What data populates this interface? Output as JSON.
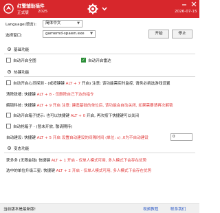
{
  "titlebar": {
    "app_title": "红警辅助插件",
    "edition": "正式版",
    "year": "2025",
    "date": "2026-07-15",
    "icons": [
      "logo-icon",
      "gear-icon",
      "chevron-down-icon",
      "minimize-icon",
      "close-icon"
    ]
  },
  "settings": {
    "language_label": "Language(语言):",
    "language_value": "简体中文",
    "process_label": "选择窗口:",
    "process_value": "gamemd-spawn.exe",
    "start_label": "开始",
    "stop_label": "停止"
  },
  "basic": {
    "title": "基础功能",
    "auto_ally_label": "自动开启全图",
    "auto_ally_checked": false,
    "auto_radar_label": "自动开启雷达",
    "auto_radar_checked": true
  },
  "hotkeys": {
    "title": "热键功能",
    "rows": [
      {
        "checked": false,
        "pre": "自动开启心灵探测 - (或按键键 ",
        "hotkey": "ALT + 7",
        "post": " 开启) 注意: 该功能需实时监控, 请务必挑选游戏设置"
      },
      {
        "pre": "清除铁墙: 快捷键 ",
        "hotkey": "ALT + 8",
        "post": " - 仅删除自己下达的指令"
      },
      {
        "pre": "解锁科技: 快捷键 ",
        "hotkey": "ALT + 9",
        "post": " 开启 注意: 建造基础的单位后, 该功能会自动关闭, 如果需要请再次解锁"
      },
      {
        "checked": false,
        "pre": "自动开启箱子提示: 也可以快捷键 ",
        "hotkey": "ALT + 0",
        "post": " 开启, 再次按下快捷键可以关闭"
      },
      {
        "checked": false,
        "pre": "自动抢箱子 - (暂未开放, 敬请期待)",
        "hotkey": "",
        "post": ""
      },
      {
        "pre": "自动建设: 快捷键 ",
        "hotkey": "ALT + 5",
        "post": " 开启 设置自动建设的间隔时间 (单位: s) ,0为不自动建设"
      }
    ],
    "interval_value": "0"
  },
  "cheats": {
    "title": "变态功能",
    "rows": [
      {
        "pre": "获多多 (无限金钱) 快捷键 ",
        "hotkey": "ALT + 1",
        "post": " 开启 - 仅单人模式可用, 多人模式下会存在优势"
      },
      {
        "pre": "选中的单位升级三星: 快捷键 ",
        "hotkey": "ALT + 2",
        "post": " 开启 - 仅单人模式可用, 多人模式下会存在优势"
      }
    ]
  },
  "statusbar": {
    "message": "当前版本是最新版!",
    "video_link": "视频教程",
    "contact_link": "联系我们"
  },
  "colors": {
    "titlebar": "#d7272c",
    "hotkey": "#e03a3a",
    "link": "#2a57c5",
    "checked": "#2d8f39"
  }
}
